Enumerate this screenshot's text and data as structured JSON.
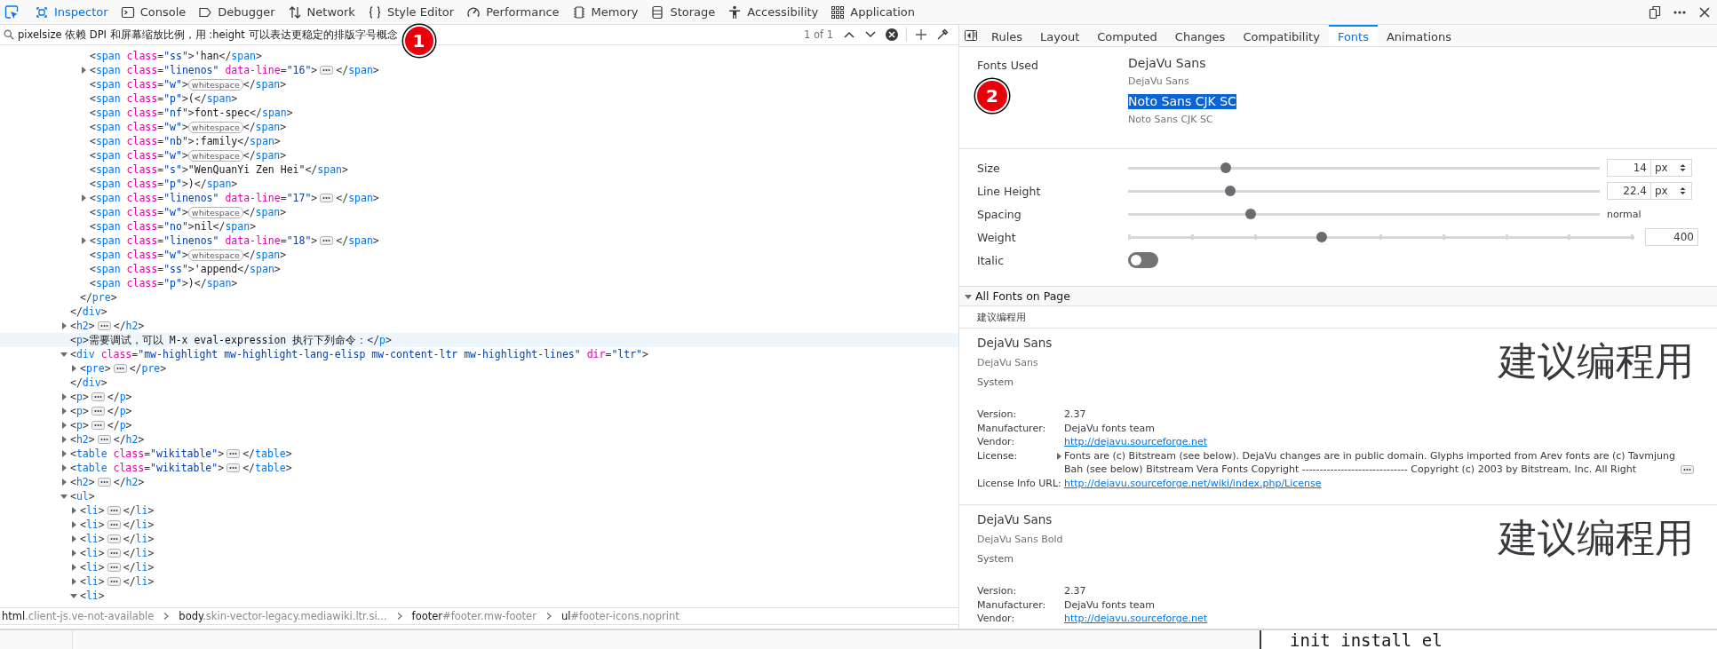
{
  "toolbox": {
    "tabs": [
      {
        "label": "Inspector",
        "selected": true
      },
      {
        "label": "Console",
        "selected": false
      },
      {
        "label": "Debugger",
        "selected": false
      },
      {
        "label": "Network",
        "selected": false
      },
      {
        "label": "Style Editor",
        "selected": false
      },
      {
        "label": "Performance",
        "selected": false
      },
      {
        "label": "Memory",
        "selected": false
      },
      {
        "label": "Storage",
        "selected": false
      },
      {
        "label": "Accessibility",
        "selected": false
      },
      {
        "label": "Application",
        "selected": false
      }
    ]
  },
  "search": {
    "value": "pixelsize 依赖 DPI 和屏幕缩放比例，用 :height 可以表达更稳定的排版字号概念",
    "count": "1 of 1",
    "marker": "1"
  },
  "markup": {
    "nodes": [
      {
        "children": [
          {
            "children": [
              {
                "highlighted": false,
                "line": [
                  {
                    "kind": "code",
                    "text": "<span class=\"ss\">'han</span>"
                  }
                ]
              },
              {
                "highlighted": false,
                "expanded": false,
                "line": [
                  {
                    "kind": "code",
                    "text": "<span class=\"linenos\" data-line=\"16\">"
                  },
                  {
                    "kind": "collapsed"
                  },
                  {
                    "kind": "code",
                    "text": "</span>"
                  }
                ]
              },
              {
                "highlighted": false,
                "line": [
                  {
                    "kind": "code",
                    "text": "<span class=\"w\">"
                  },
                  {
                    "kind": "whitespace",
                    "text": "whitespace"
                  },
                  {
                    "kind": "code",
                    "text": "</span>"
                  }
                ]
              },
              {
                "highlighted": false,
                "line": [
                  {
                    "kind": "code",
                    "text": "<span class=\"p\">(</span>"
                  }
                ]
              },
              {
                "highlighted": false,
                "line": [
                  {
                    "kind": "code",
                    "text": "<span class=\"nf\">font-spec</span>"
                  }
                ]
              },
              {
                "highlighted": false,
                "line": [
                  {
                    "kind": "code",
                    "text": "<span class=\"w\">"
                  },
                  {
                    "kind": "whitespace",
                    "text": "whitespace"
                  },
                  {
                    "kind": "code",
                    "text": "</span>"
                  }
                ]
              },
              {
                "highlighted": false,
                "line": [
                  {
                    "kind": "code",
                    "text": "<span class=\"nb\">:family</span>"
                  }
                ]
              },
              {
                "highlighted": false,
                "line": [
                  {
                    "kind": "code",
                    "text": "<span class=\"w\">"
                  },
                  {
                    "kind": "whitespace",
                    "text": "whitespace"
                  },
                  {
                    "kind": "code",
                    "text": "</span>"
                  }
                ]
              },
              {
                "highlighted": false,
                "line": [
                  {
                    "kind": "code",
                    "text": "<span class=\"s\">\"WenQuanYi Zen Hei\"</span>"
                  }
                ]
              },
              {
                "highlighted": false,
                "line": [
                  {
                    "kind": "code",
                    "text": "<span class=\"p\">)</span>"
                  }
                ]
              },
              {
                "highlighted": false,
                "expanded": false,
                "line": [
                  {
                    "kind": "code",
                    "text": "<span class=\"linenos\" data-line=\"17\">"
                  },
                  {
                    "kind": "collapsed"
                  },
                  {
                    "kind": "code",
                    "text": "</span>"
                  }
                ]
              },
              {
                "highlighted": false,
                "line": [
                  {
                    "kind": "code",
                    "text": "<span class=\"w\">"
                  },
                  {
                    "kind": "whitespace",
                    "text": "whitespace"
                  },
                  {
                    "kind": "code",
                    "text": "</span>"
                  }
                ]
              },
              {
                "highlighted": false,
                "line": [
                  {
                    "kind": "code",
                    "text": "<span class=\"no\">nil</span>"
                  }
                ]
              },
              {
                "highlighted": false,
                "expanded": false,
                "line": [
                  {
                    "kind": "code",
                    "text": "<span class=\"linenos\" data-line=\"18\">"
                  },
                  {
                    "kind": "collapsed"
                  },
                  {
                    "kind": "code",
                    "text": "</span>"
                  }
                ]
              },
              {
                "highlighted": false,
                "line": [
                  {
                    "kind": "code",
                    "text": "<span class=\"w\">"
                  },
                  {
                    "kind": "whitespace",
                    "text": "whitespace"
                  },
                  {
                    "kind": "code",
                    "text": "</span>"
                  }
                ]
              },
              {
                "highlighted": false,
                "line": [
                  {
                    "kind": "code",
                    "text": "<span class=\"ss\">'append</span>"
                  }
                ]
              },
              {
                "highlighted": false,
                "line": [
                  {
                    "kind": "code",
                    "text": "<span class=\"p\">)</span>"
                  }
                ]
              }
            ],
            "close": [
              {
                "kind": "code",
                "text": "</pre>"
              }
            ]
          }
        ],
        "close": [
          {
            "kind": "code",
            "text": "</div>"
          }
        ]
      },
      {
        "highlighted": false,
        "expanded": false,
        "line": [
          {
            "kind": "code",
            "text": "<h2>"
          },
          {
            "kind": "collapsed"
          },
          {
            "kind": "code",
            "text": "</h2>"
          }
        ]
      },
      {
        "highlighted": true,
        "line": [
          {
            "kind": "code",
            "text": "<p>需要调试，可以 M-x eval-expression 执行下列命令：</p>"
          }
        ]
      },
      {
        "highlighted": false,
        "expanded": true,
        "line": [
          {
            "kind": "code",
            "text": "<div class=\"mw-highlight mw-highlight-lang-elisp mw-content-ltr mw-highlight-lines\" dir=\"ltr\">"
          }
        ],
        "children": [
          {
            "highlighted": false,
            "expanded": false,
            "line": [
              {
                "kind": "code",
                "text": "<pre>"
              },
              {
                "kind": "collapsed"
              },
              {
                "kind": "code",
                "text": "</pre>"
              }
            ]
          }
        ],
        "close": [
          {
            "kind": "code",
            "text": "</div>"
          }
        ]
      },
      {
        "highlighted": false,
        "expanded": false,
        "line": [
          {
            "kind": "code",
            "text": "<p>"
          },
          {
            "kind": "collapsed"
          },
          {
            "kind": "code",
            "text": "</p>"
          }
        ]
      },
      {
        "highlighted": false,
        "expanded": false,
        "line": [
          {
            "kind": "code",
            "text": "<p>"
          },
          {
            "kind": "collapsed"
          },
          {
            "kind": "code",
            "text": "</p>"
          }
        ]
      },
      {
        "highlighted": false,
        "expanded": false,
        "line": [
          {
            "kind": "code",
            "text": "<p>"
          },
          {
            "kind": "collapsed"
          },
          {
            "kind": "code",
            "text": "</p>"
          }
        ]
      },
      {
        "highlighted": false,
        "expanded": false,
        "line": [
          {
            "kind": "code",
            "text": "<h2>"
          },
          {
            "kind": "collapsed"
          },
          {
            "kind": "code",
            "text": "</h2>"
          }
        ]
      },
      {
        "highlighted": false,
        "expanded": false,
        "line": [
          {
            "kind": "code",
            "text": "<table class=\"wikitable\">"
          },
          {
            "kind": "collapsed"
          },
          {
            "kind": "code",
            "text": "</table>"
          }
        ]
      },
      {
        "highlighted": false,
        "expanded": false,
        "line": [
          {
            "kind": "code",
            "text": "<table class=\"wikitable\">"
          },
          {
            "kind": "collapsed"
          },
          {
            "kind": "code",
            "text": "</table>"
          }
        ]
      },
      {
        "highlighted": false,
        "expanded": false,
        "line": [
          {
            "kind": "code",
            "text": "<h2>"
          },
          {
            "kind": "collapsed"
          },
          {
            "kind": "code",
            "text": "</h2>"
          }
        ]
      },
      {
        "highlighted": false,
        "expanded": true,
        "line": [
          {
            "kind": "code",
            "text": "<ul>"
          }
        ],
        "children": [
          {
            "highlighted": false,
            "expanded": false,
            "line": [
              {
                "kind": "code",
                "text": "<li>"
              },
              {
                "kind": "collapsed"
              },
              {
                "kind": "code",
                "text": "</li>"
              }
            ]
          },
          {
            "highlighted": false,
            "expanded": false,
            "line": [
              {
                "kind": "code",
                "text": "<li>"
              },
              {
                "kind": "collapsed"
              },
              {
                "kind": "code",
                "text": "</li>"
              }
            ]
          },
          {
            "highlighted": false,
            "expanded": false,
            "line": [
              {
                "kind": "code",
                "text": "<li>"
              },
              {
                "kind": "collapsed"
              },
              {
                "kind": "code",
                "text": "</li>"
              }
            ]
          },
          {
            "highlighted": false,
            "expanded": false,
            "line": [
              {
                "kind": "code",
                "text": "<li>"
              },
              {
                "kind": "collapsed"
              },
              {
                "kind": "code",
                "text": "</li>"
              }
            ]
          },
          {
            "highlighted": false,
            "expanded": false,
            "line": [
              {
                "kind": "code",
                "text": "<li>"
              },
              {
                "kind": "collapsed"
              },
              {
                "kind": "code",
                "text": "</li>"
              }
            ]
          },
          {
            "highlighted": false,
            "expanded": false,
            "line": [
              {
                "kind": "code",
                "text": "<li>"
              },
              {
                "kind": "collapsed"
              },
              {
                "kind": "code",
                "text": "</li>"
              }
            ]
          },
          {
            "highlighted": false,
            "expanded": true,
            "line": [
              {
                "kind": "code",
                "text": "<li>"
              }
            ]
          }
        ]
      }
    ]
  },
  "breadcrumbs": [
    {
      "tag": "html",
      "detail": ".client-js.ve-not-available"
    },
    {
      "tag": "body",
      "detail": ".skin-vector-legacy.mediawiki.ltr.si..."
    },
    {
      "tag": "footer",
      "detail": "#footer.mw-footer"
    },
    {
      "tag": "ul",
      "detail": "#footer-icons.noprint"
    }
  ],
  "sidebar": {
    "tabs": [
      {
        "label": "Rules",
        "selected": false
      },
      {
        "label": "Layout",
        "selected": false
      },
      {
        "label": "Computed",
        "selected": false
      },
      {
        "label": "Changes",
        "selected": false
      },
      {
        "label": "Compatibility",
        "selected": false
      },
      {
        "label": "Fonts",
        "selected": true
      },
      {
        "label": "Animations",
        "selected": false
      }
    ],
    "fonts_used": {
      "label": "Fonts Used",
      "marker": "2",
      "fonts": [
        {
          "name": "DejaVu Sans",
          "source": "DejaVu Sans",
          "selected": false
        },
        {
          "name": "Noto Sans CJK SC",
          "source": "Noto Sans CJK SC",
          "selected": true
        }
      ]
    },
    "properties": [
      {
        "kind": "unit",
        "label": "Size",
        "level": 0.2,
        "value": "14",
        "unit": "px"
      },
      {
        "kind": "unit",
        "label": "Line Height",
        "level": 0.21,
        "value": "22.4",
        "unit": "px"
      },
      {
        "kind": "reading",
        "label": "Spacing",
        "level": 0.255,
        "reading": "normal"
      },
      {
        "kind": "stepped",
        "label": "Weight",
        "level": 0.38,
        "value": "400"
      },
      {
        "kind": "toggle",
        "label": "Italic",
        "on": false
      }
    ],
    "all_fonts": {
      "label": "All Fonts on Page",
      "expanded": true,
      "preview_text": "建议编程用",
      "fonts": [
        {
          "name": "DejaVu Sans",
          "full_name": "DejaVu Sans",
          "origin": "System",
          "preview": "建议编程用",
          "details": [
            {
              "kind": "text",
              "label": "Version:",
              "value": "2.37"
            },
            {
              "kind": "text",
              "label": "Manufacturer:",
              "value": "DejaVu fonts team"
            },
            {
              "kind": "link",
              "label": "Vendor:",
              "value": "http://dejavu.sourceforge.net"
            },
            {
              "kind": "expandable",
              "label": "License:",
              "expanded": false,
              "value": "Fonts are (c) Bitstream (see below). DejaVu changes are in public domain. Glyphs imported from Arev fonts are (c) Tavmjung Bah (see below) Bitstream Vera Fonts Copyright ------------------------------ Copyright (c) 2003 by Bitstream, Inc. All Right"
            },
            {
              "kind": "link",
              "label": "License Info URL:",
              "value": "http://dejavu.sourceforge.net/wiki/index.php/License"
            }
          ]
        },
        {
          "name": "DejaVu Sans",
          "full_name": "DejaVu Sans Bold",
          "origin": "System",
          "preview": "建议编程用",
          "details": [
            {
              "kind": "text",
              "label": "Version:",
              "value": "2.37"
            },
            {
              "kind": "text",
              "label": "Manufacturer:",
              "value": "DejaVu fonts team"
            },
            {
              "kind": "link",
              "label": "Vendor:",
              "value": "http://dejavu.sourceforge.net"
            }
          ]
        }
      ]
    }
  },
  "bottom_pane": {
    "code_line": "init install el"
  }
}
